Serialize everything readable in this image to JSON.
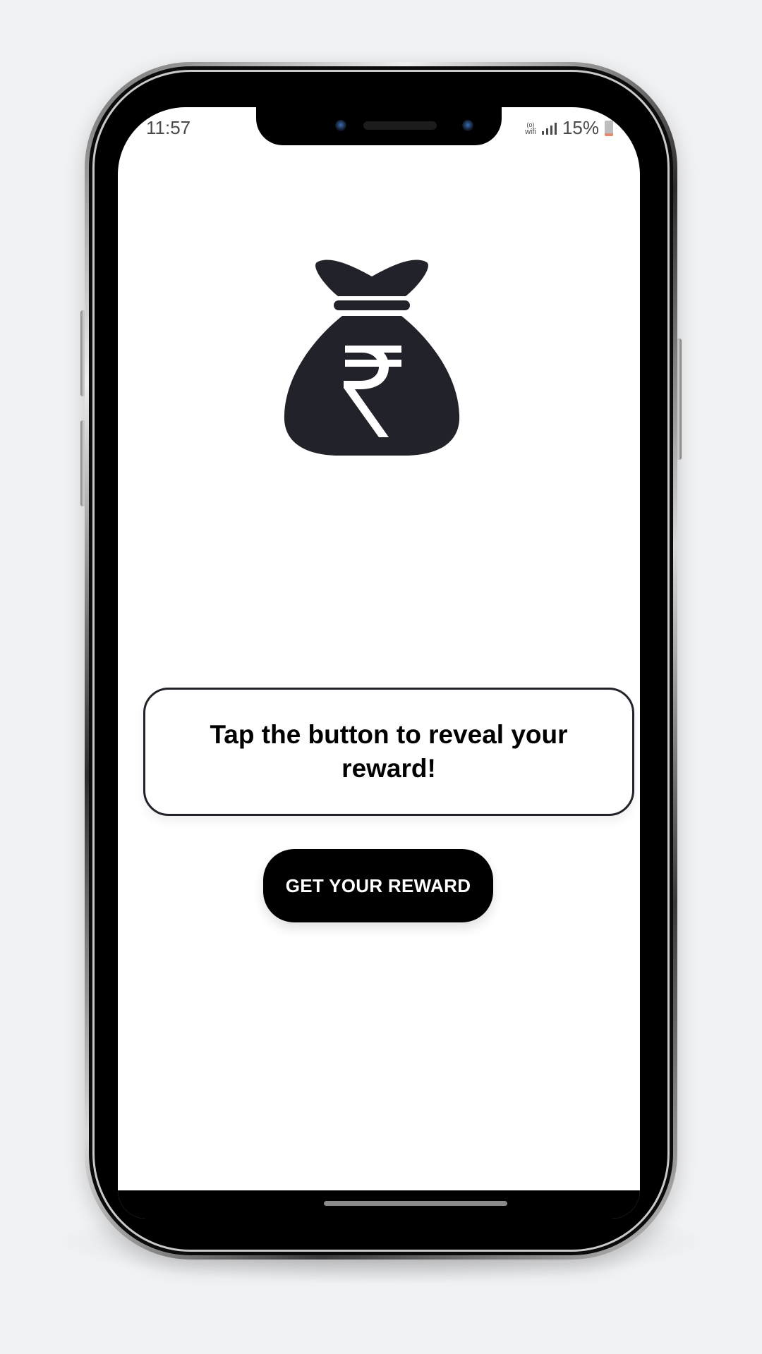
{
  "status_bar": {
    "time": "11:57",
    "wifi_label": "wifi",
    "battery_percent": "15%"
  },
  "main": {
    "icon": "money-bag-rupee-icon",
    "message": "Tap the button to reveal your reward!",
    "button_label": "GET YOUR REWARD"
  },
  "colors": {
    "background": "#f1f2f4",
    "screen": "#ffffff",
    "icon": "#22232a",
    "button": "#000000",
    "button_text": "#ffffff",
    "card_border": "#22232a"
  }
}
